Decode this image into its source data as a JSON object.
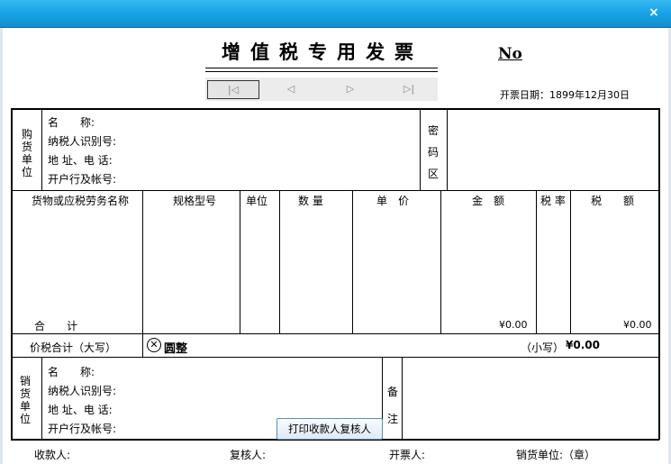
{
  "window": {
    "close_icon": "×"
  },
  "invoice": {
    "title": "增值税专用发票",
    "number_label": "No",
    "date_label": "开票日期：1899年12月30日"
  },
  "nav": {
    "first": "|◁",
    "prev": "◁",
    "next": "▷",
    "last": "▷|"
  },
  "buyer": {
    "section": [
      "购",
      "货",
      "单",
      "位"
    ],
    "name": "名　　称:",
    "taxid": "纳税人识别号:",
    "address": "地 址、电 话:",
    "bank": "开户行及帐号:",
    "cipher": [
      "密",
      "码",
      "区"
    ]
  },
  "columns": {
    "goods": "货物或应税劳务名称",
    "spec": "规格型号",
    "unit": "单位",
    "qty": "数 量",
    "price": "单　价",
    "amount": "金　额",
    "rate": "税 率",
    "tax": "税　　额"
  },
  "totals": {
    "label": "合　　计",
    "amount": "¥0.00",
    "tax": "¥0.00",
    "total_label": "价税合计（大写）",
    "total_words": "圆整",
    "small_label": "（小写）",
    "small_value": "¥0.00"
  },
  "seller": {
    "section": [
      "销",
      "货",
      "单",
      "位"
    ],
    "name": "名　　称:",
    "taxid": "纳税人识别号:",
    "address": "地 址、电 话:",
    "bank": "开户行及帐号:",
    "remark": [
      "备",
      "注"
    ],
    "print_button": "打印收款人复核人"
  },
  "footer": {
    "payee": "收款人:",
    "reviewer": "复核人:",
    "drawer": "开票人:",
    "seller_stamp": "销货单位:（章）"
  }
}
